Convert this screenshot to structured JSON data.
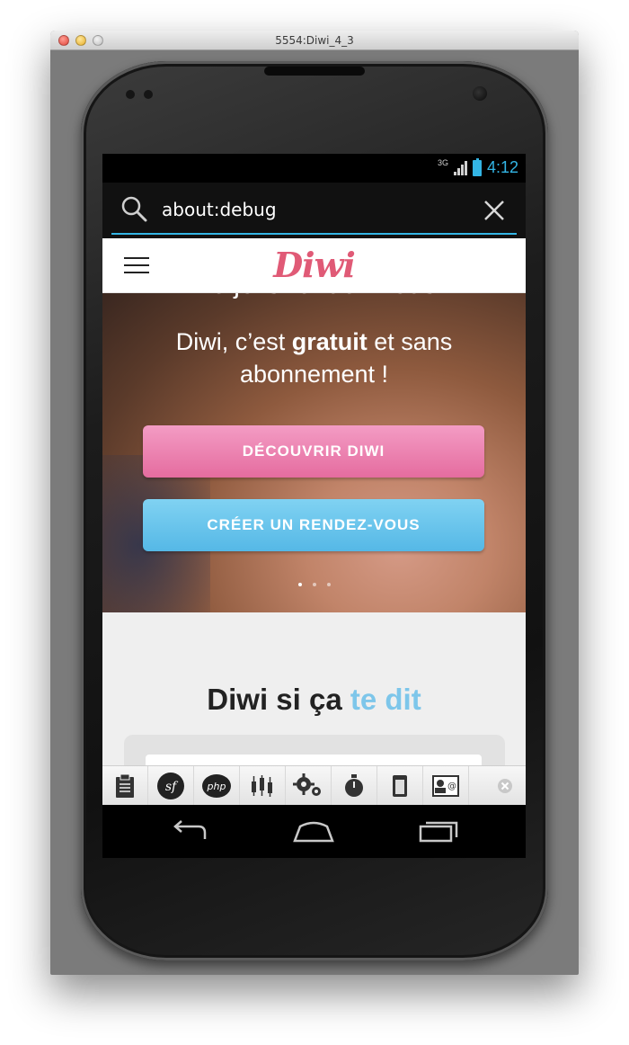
{
  "window": {
    "title": "5554:Diwi_4_3"
  },
  "status_bar": {
    "network": "3G",
    "time": "4:12"
  },
  "url_bar": {
    "value": "about:debug"
  },
  "site": {
    "logo": "Diwi",
    "hero_title_partial": "De jolis rendez-vous",
    "hero_sub_pre": "Diwi, c’est ",
    "hero_sub_bold": "gratuit",
    "hero_sub_post": " et sans abonnement !",
    "btn_discover": "DÉCOUVRIR DIWI",
    "btn_create": "CRÉER UN RENDEZ-VOUS",
    "carousel": {
      "count": 3,
      "active_index": 0
    },
    "section_title_main": "Diwi si ça ",
    "section_title_accent": "te dit"
  },
  "debug_toolbar": {
    "items": [
      "clipboard-icon",
      "symfony-icon",
      "php-icon",
      "timeline-icon",
      "gears-icon",
      "stopwatch-icon",
      "memory-icon",
      "user-card-icon"
    ]
  },
  "colors": {
    "brand_pink": "#e05a76",
    "button_pink": "#e56c9f",
    "button_blue": "#55b8e6",
    "accent_blue": "#7dc6ea",
    "android_holo_blue": "#33b5e5"
  }
}
